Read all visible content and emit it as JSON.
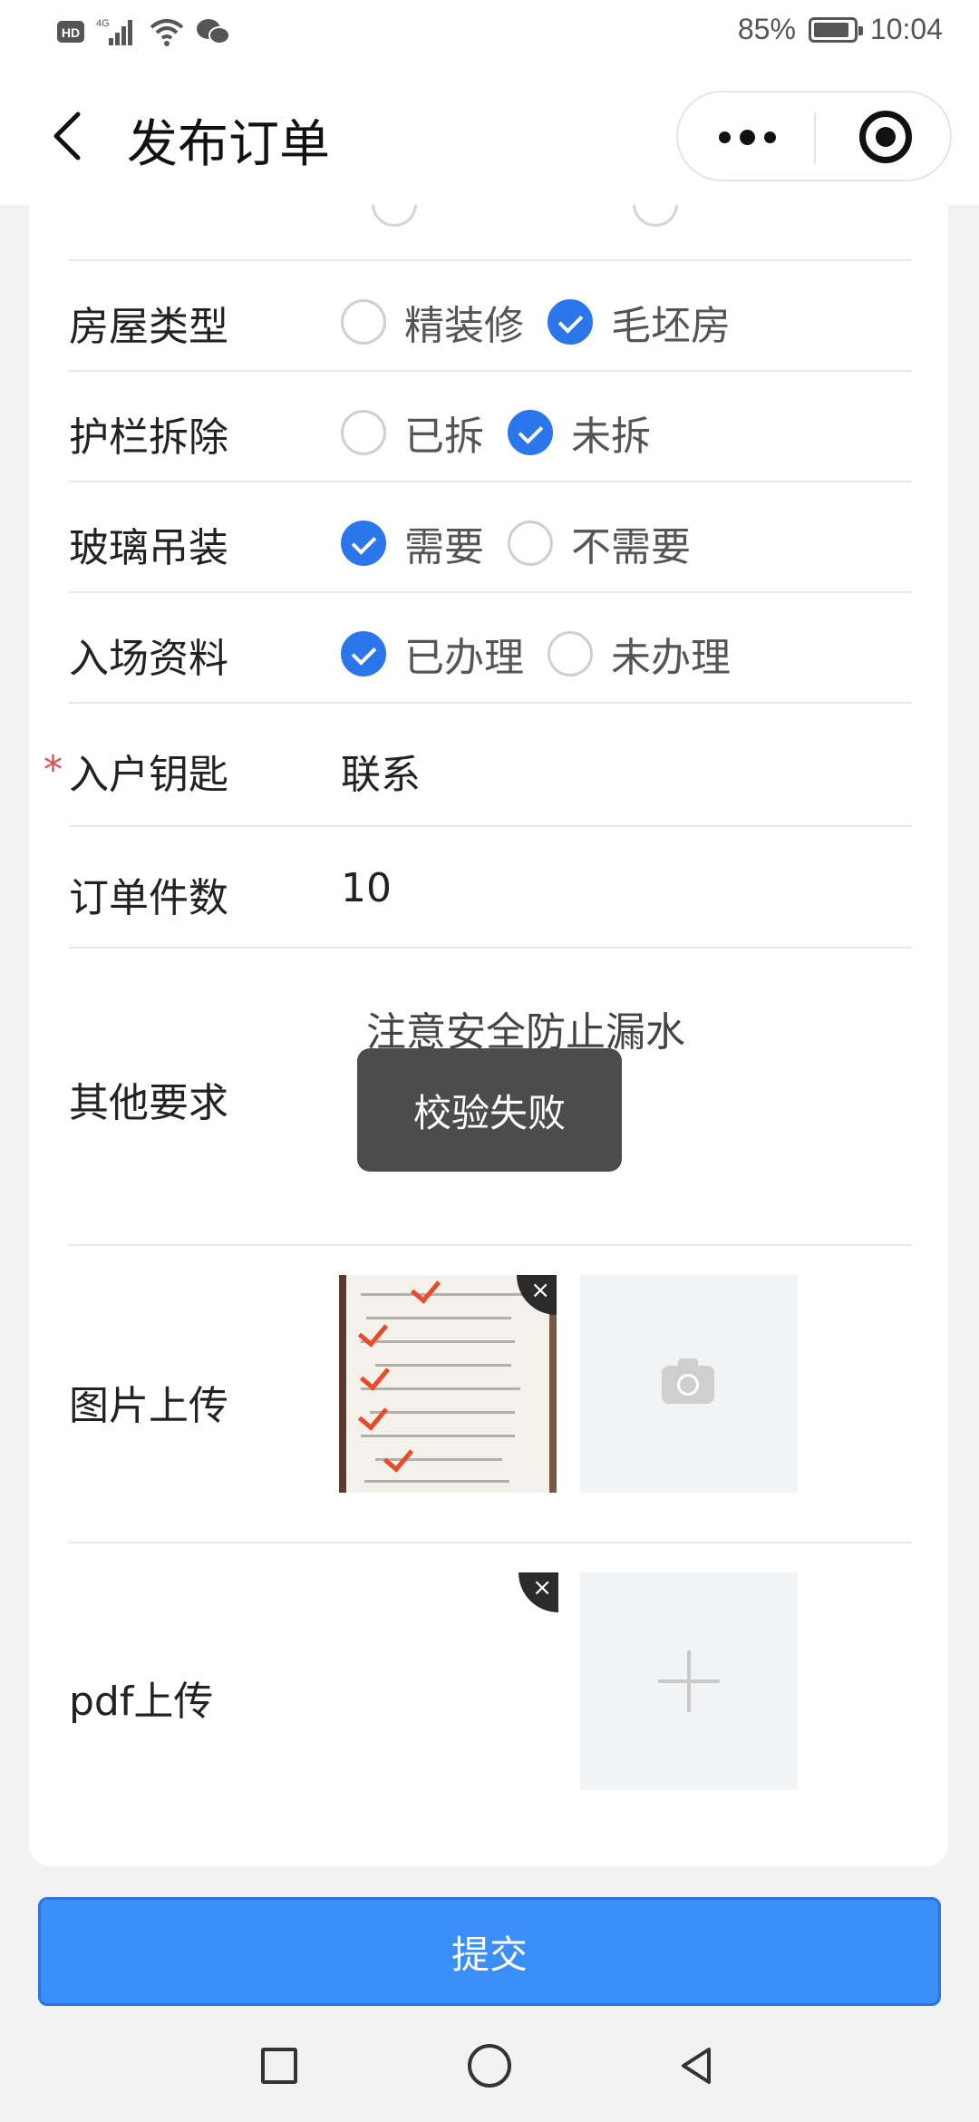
{
  "status_bar": {
    "battery": "85%",
    "time": "10:04",
    "battery_level": 0.85
  },
  "nav": {
    "title": "发布订单"
  },
  "form": {
    "house_type": {
      "label": "房屋类型",
      "options": [
        "精装修",
        "毛坯房"
      ],
      "selected": 1
    },
    "railing": {
      "label": "护栏拆除",
      "options": [
        "已拆",
        "未拆"
      ],
      "selected": 1
    },
    "glass": {
      "label": "玻璃吊装",
      "options": [
        "需要",
        "不需要"
      ],
      "selected": 0
    },
    "entry_docs": {
      "label": "入场资料",
      "options": [
        "已办理",
        "未办理"
      ],
      "selected": 0
    },
    "key": {
      "required_mark": "*",
      "label": "入户钥匙",
      "value": "联系"
    },
    "quantity": {
      "label": "订单件数",
      "value": "10"
    },
    "other": {
      "label": "其他要求",
      "value": "注意安全防止漏水"
    },
    "image_upload": {
      "label": "图片上传"
    },
    "pdf_upload": {
      "label": "pdf上传"
    },
    "delete_glyph": "×"
  },
  "toast": {
    "text": "校验失败"
  },
  "submit": {
    "label": "提交"
  },
  "colors": {
    "accent": "#2a76ea",
    "submit": "#3b8ef7",
    "required": "#e14b4b",
    "toast": "#4c4c4c"
  }
}
